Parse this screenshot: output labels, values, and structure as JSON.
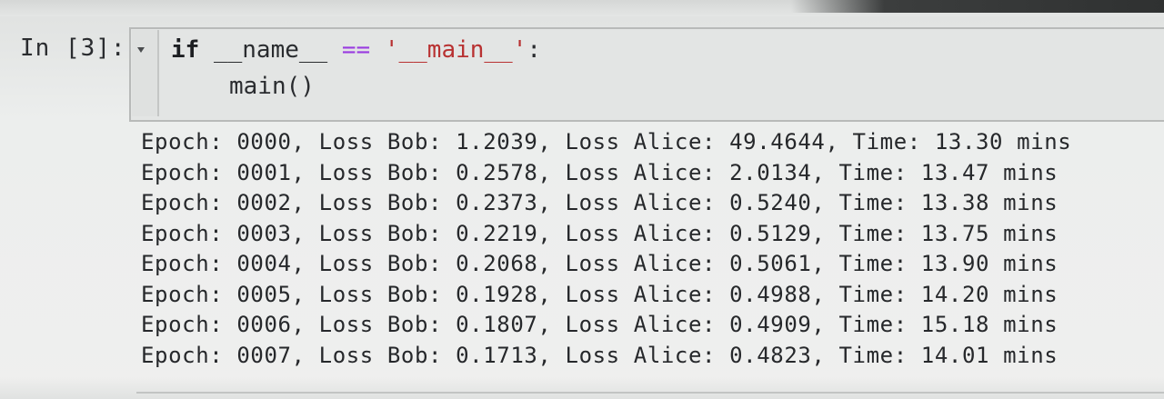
{
  "cell": {
    "prompt": "In [3]:",
    "code": {
      "keyword_if": "if",
      "name_dunder": "__name__",
      "operator": "==",
      "main_string": "'__main__'",
      "colon": ":",
      "call": "main()"
    }
  },
  "output": {
    "lines": [
      "Epoch: 0000, Loss Bob: 1.2039, Loss Alice: 49.4644, Time: 13.30 mins",
      "Epoch: 0001, Loss Bob: 0.2578, Loss Alice: 2.0134, Time: 13.47 mins",
      "Epoch: 0002, Loss Bob: 0.2373, Loss Alice: 0.5240, Time: 13.38 mins",
      "Epoch: 0003, Loss Bob: 0.2219, Loss Alice: 0.5129, Time: 13.75 mins",
      "Epoch: 0004, Loss Bob: 0.2068, Loss Alice: 0.5061, Time: 13.90 mins",
      "Epoch: 0005, Loss Bob: 0.1928, Loss Alice: 0.4988, Time: 14.20 mins",
      "Epoch: 0006, Loss Bob: 0.1807, Loss Alice: 0.4909, Time: 15.18 mins",
      "Epoch: 0007, Loss Bob: 0.1713, Loss Alice: 0.4823, Time: 14.01 mins"
    ]
  },
  "colors": {
    "keyword": "#1d1f22",
    "operator": "#9a3ce0",
    "string": "#b83131",
    "text": "#26282b",
    "background": "#efefee"
  },
  "icons": {
    "collapse": "collapse-arrow-icon"
  }
}
